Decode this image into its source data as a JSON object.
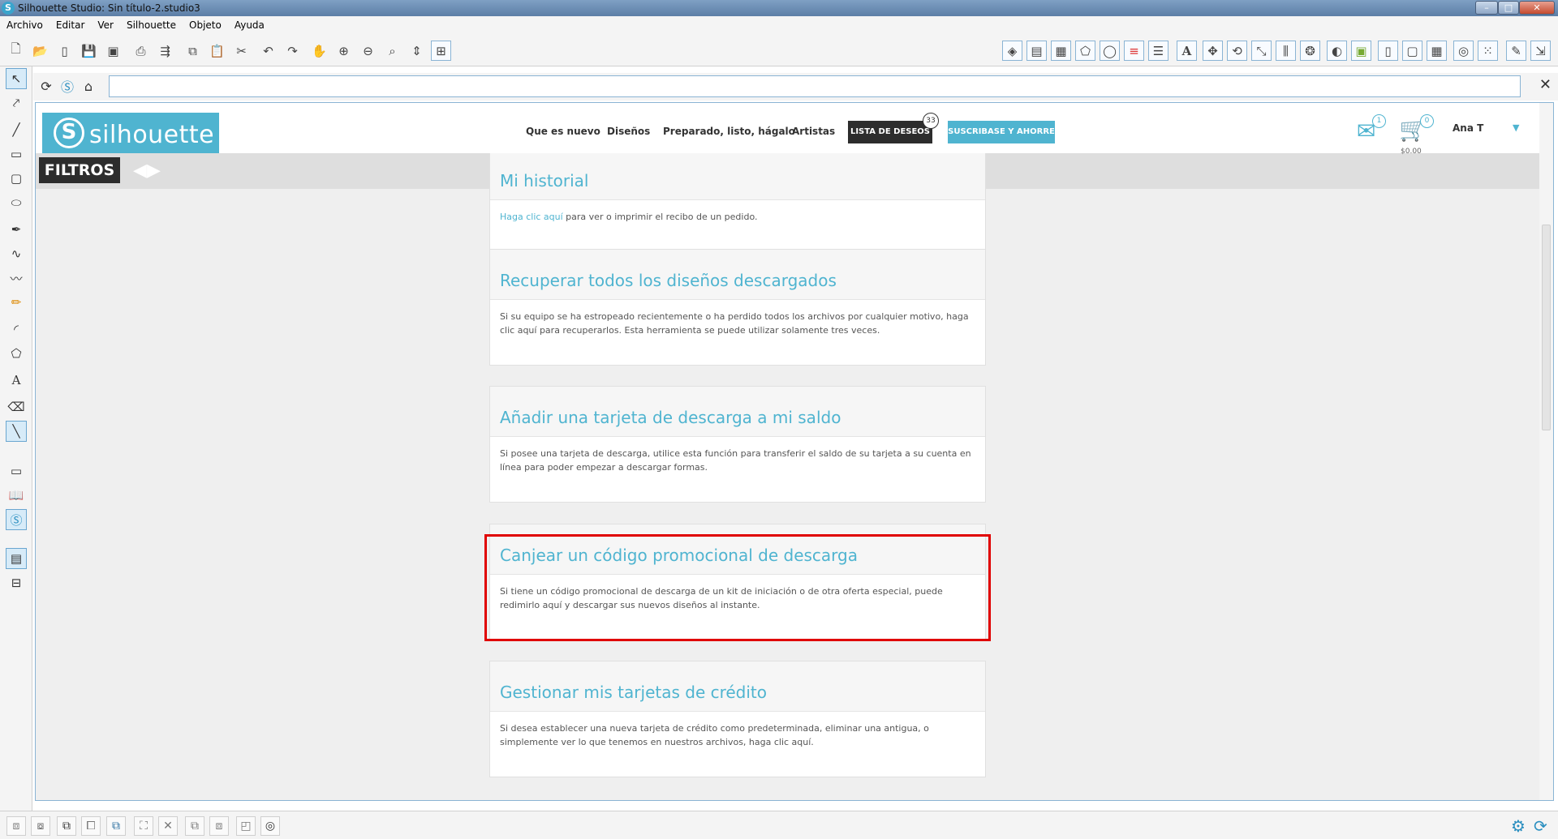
{
  "window": {
    "title": "Silhouette Studio: Sin título-2.studio3"
  },
  "menu": [
    "Archivo",
    "Editar",
    "Ver",
    "Silhouette",
    "Objeto",
    "Ayuda"
  ],
  "site": {
    "logo_word": "silhouette",
    "nav": [
      "Que es nuevo",
      "Diseños",
      "Preparado, listo, hágalo",
      "Artistas"
    ],
    "wishlist": {
      "label": "LISTA DE DESEOS",
      "count": "33"
    },
    "subscribe": "SUSCRIBASE Y AHORRE",
    "messages_count": "1",
    "cart": {
      "count": "0",
      "total": "$0.00"
    },
    "user": "Ana T"
  },
  "filters": {
    "label": "FILTROS"
  },
  "search": {
    "value": ""
  },
  "cards": [
    {
      "title": "Mi historial",
      "link": "Haga clic aquí",
      "text": " para ver o imprimir el recibo de un pedido."
    },
    {
      "title": "Recuperar todos los diseños descargados",
      "text": "Si su equipo se ha estropeado recientemente o ha perdido todos los archivos por cualquier motivo, haga clic aquí para recuperarlos. Esta herramienta se puede utilizar solamente tres veces."
    },
    {
      "title": "Añadir una tarjeta de descarga a mi saldo",
      "text": "Si posee una tarjeta de descarga, utilice esta función para transferir el saldo de su tarjeta a su cuenta en línea para poder empezar a descargar formas."
    },
    {
      "title": "Canjear un código promocional de descarga",
      "text": "Si tiene un código promocional de descarga de un kit de iniciación o de otra oferta especial, puede redimirlo aquí y descargar sus nuevos diseños al instante."
    },
    {
      "title": "Gestionar mis tarjetas de crédito",
      "text": "Si desea establecer una nueva tarjeta de crédito como predeterminada, eliminar una antigua, o simplemente ver lo que tenemos en nuestros archivos, haga clic aquí."
    }
  ],
  "colors": {
    "accent": "#4fb4d0",
    "highlight": "#e00000",
    "dark": "#2d2d2d"
  }
}
